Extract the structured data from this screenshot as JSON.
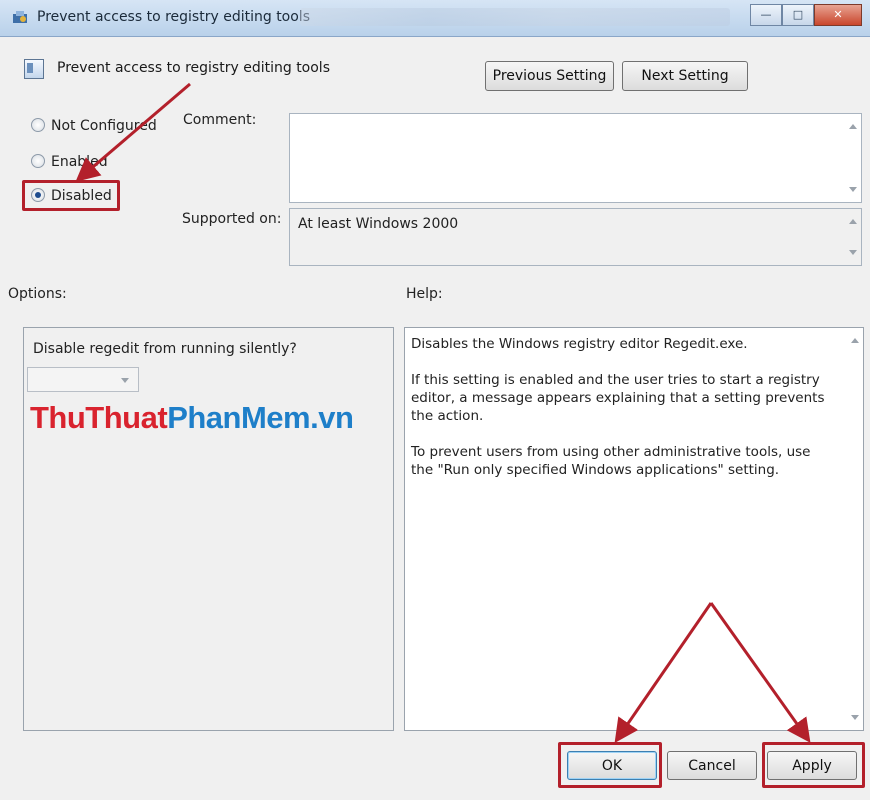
{
  "window": {
    "title": "Prevent access to registry editing tools"
  },
  "header": {
    "title": "Prevent access to registry editing tools",
    "previous_label": "Previous Setting",
    "next_label": "Next Setting"
  },
  "radios": [
    {
      "label": "Not Configured",
      "selected": false
    },
    {
      "label": "Enabled",
      "selected": false
    },
    {
      "label": "Disabled",
      "selected": true
    }
  ],
  "comment": {
    "label": "Comment:",
    "value": ""
  },
  "supported": {
    "label": "Supported on:",
    "value": "At least Windows 2000"
  },
  "options": {
    "label": "Options:",
    "question": "Disable regedit from running silently?",
    "dropdown_value": ""
  },
  "help": {
    "label": "Help:",
    "p1": "Disables the Windows registry editor Regedit.exe.",
    "p2": "If this setting is enabled and the user tries to start a registry editor, a message appears explaining that a setting prevents the action.",
    "p3": "To prevent users from using other administrative tools, use the \"Run only specified Windows applications\" setting."
  },
  "watermark": {
    "part1": "ThuThuat",
    "part2": "PhanMem",
    "part3": ".vn"
  },
  "footer": {
    "ok_label": "OK",
    "cancel_label": "Cancel",
    "apply_label": "Apply"
  },
  "colors": {
    "annotation_red": "#b3202b",
    "wm_red": "#d9232e",
    "wm_blue": "#1e7fc9"
  }
}
